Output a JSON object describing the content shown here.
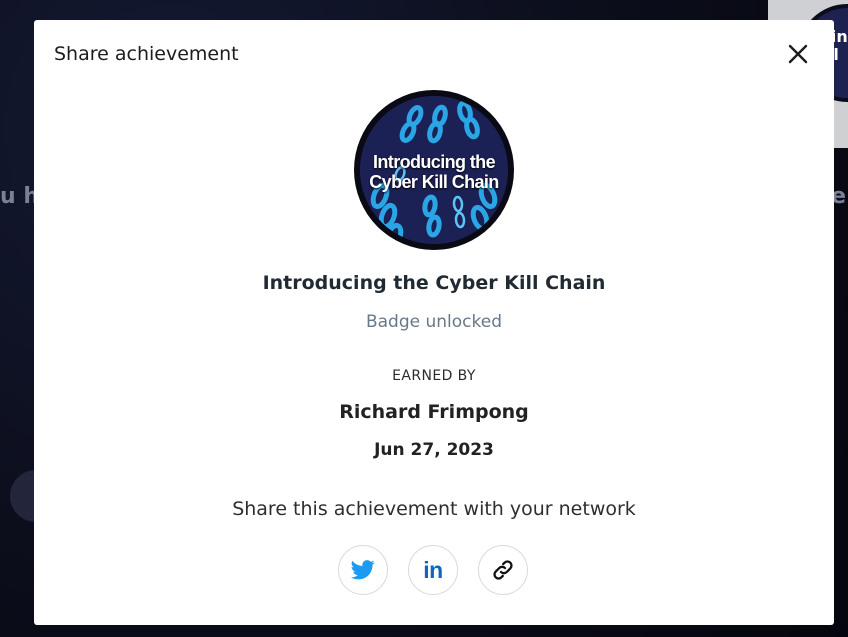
{
  "background": {
    "left_fragment": "u ha",
    "right_fragment": "e",
    "thumbnail_text": "ucing Kill"
  },
  "modal": {
    "title": "Share achievement",
    "badge_image_text": "Introducing the Cyber Kill Chain",
    "achievement_name": "Introducing the Cyber Kill Chain",
    "status": "Badge unlocked",
    "earned_by_label": "EARNED BY",
    "earner_name": "Richard Frimpong",
    "date": "Jun 27, 2023",
    "share_prompt": "Share this achievement with your network",
    "share_buttons": [
      {
        "icon": "twitter-icon",
        "color": "#1d9bf0"
      },
      {
        "icon": "linkedin-icon",
        "glyph": "in",
        "color": "#0a66c2"
      },
      {
        "icon": "link-icon",
        "color": "#111111"
      }
    ]
  },
  "colors": {
    "overlay": "#0b0d1a",
    "modal_bg": "#ffffff",
    "muted_text": "#67788a",
    "twitter_blue": "#1d9bf0",
    "linkedin_blue": "#0a66c2"
  }
}
